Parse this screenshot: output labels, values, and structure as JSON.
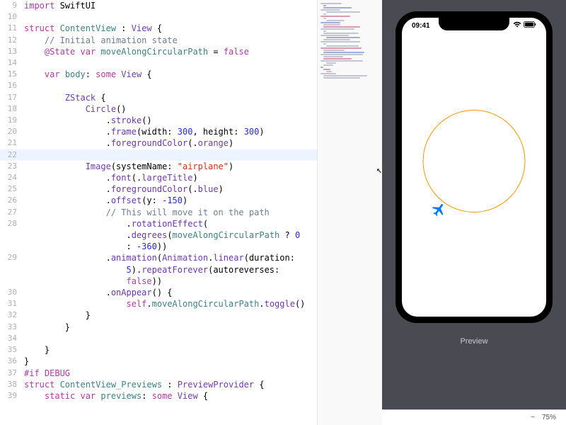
{
  "editor": {
    "lines": [
      {
        "n": 9,
        "indent": 0,
        "tokens": [
          [
            "import ",
            "kw-pink"
          ],
          [
            "SwiftUI",
            "kw-black"
          ]
        ]
      },
      {
        "n": 10,
        "indent": 0,
        "tokens": []
      },
      {
        "n": 11,
        "indent": 0,
        "tokens": [
          [
            "struct ",
            "kw-pink"
          ],
          [
            "ContentView",
            "kw-type-user"
          ],
          [
            " : ",
            "kw-black"
          ],
          [
            "View",
            "kw-purple-type"
          ],
          [
            " {",
            "kw-black"
          ]
        ]
      },
      {
        "n": 12,
        "indent": 1,
        "tokens": [
          [
            "// Initial animation state",
            "kw-comment"
          ]
        ]
      },
      {
        "n": 13,
        "indent": 1,
        "tokens": [
          [
            "@State",
            "kw-pink"
          ],
          [
            " ",
            "kw-black"
          ],
          [
            "var ",
            "kw-pink"
          ],
          [
            "moveAlongCircularPath",
            "kw-prop"
          ],
          [
            " = ",
            "kw-black"
          ],
          [
            "false",
            "kw-bool"
          ]
        ]
      },
      {
        "n": 14,
        "indent": 0,
        "tokens": []
      },
      {
        "n": 15,
        "indent": 1,
        "tokens": [
          [
            "var ",
            "kw-pink"
          ],
          [
            "body",
            "kw-prop"
          ],
          [
            ": ",
            "kw-black"
          ],
          [
            "some ",
            "kw-pink"
          ],
          [
            "View",
            "kw-purple-type"
          ],
          [
            " {",
            "kw-black"
          ]
        ]
      },
      {
        "n": 16,
        "indent": 0,
        "tokens": []
      },
      {
        "n": 17,
        "indent": 2,
        "tokens": [
          [
            "ZStack",
            "kw-purple-type"
          ],
          [
            " {",
            "kw-black"
          ]
        ]
      },
      {
        "n": 18,
        "indent": 3,
        "tokens": [
          [
            "Circle",
            "kw-purple-type"
          ],
          [
            "()",
            "kw-black"
          ]
        ]
      },
      {
        "n": 19,
        "indent": 4,
        "tokens": [
          [
            ".",
            "kw-black"
          ],
          [
            "stroke",
            "kw-method"
          ],
          [
            "()",
            "kw-black"
          ]
        ]
      },
      {
        "n": 20,
        "indent": 4,
        "tokens": [
          [
            ".",
            "kw-black"
          ],
          [
            "frame",
            "kw-method"
          ],
          [
            "(width: ",
            "kw-black"
          ],
          [
            "300",
            "kw-number"
          ],
          [
            ", height: ",
            "kw-black"
          ],
          [
            "300",
            "kw-number"
          ],
          [
            ")",
            "kw-black"
          ]
        ]
      },
      {
        "n": 21,
        "indent": 4,
        "tokens": [
          [
            ".",
            "kw-black"
          ],
          [
            "foregroundColor",
            "kw-method"
          ],
          [
            "(.",
            "kw-black"
          ],
          [
            "orange",
            "kw-enum"
          ],
          [
            ")",
            "kw-black"
          ]
        ]
      },
      {
        "n": 22,
        "indent": 4,
        "current": true,
        "tokens": []
      },
      {
        "n": 23,
        "indent": 3,
        "tokens": [
          [
            "Image",
            "kw-purple-type"
          ],
          [
            "(systemName: ",
            "kw-black"
          ],
          [
            "\"airplane\"",
            "kw-string"
          ],
          [
            ")",
            "kw-black"
          ]
        ]
      },
      {
        "n": 24,
        "indent": 4,
        "tokens": [
          [
            ".",
            "kw-black"
          ],
          [
            "font",
            "kw-method"
          ],
          [
            "(.",
            "kw-black"
          ],
          [
            "largeTitle",
            "kw-enum"
          ],
          [
            ")",
            "kw-black"
          ]
        ]
      },
      {
        "n": 25,
        "indent": 4,
        "tokens": [
          [
            ".",
            "kw-black"
          ],
          [
            "foregroundColor",
            "kw-method"
          ],
          [
            "(.",
            "kw-black"
          ],
          [
            "blue",
            "kw-enum"
          ],
          [
            ")",
            "kw-black"
          ]
        ]
      },
      {
        "n": 26,
        "indent": 4,
        "tokens": [
          [
            ".",
            "kw-black"
          ],
          [
            "offset",
            "kw-method"
          ],
          [
            "(y: ",
            "kw-black"
          ],
          [
            "-150",
            "kw-number"
          ],
          [
            ")",
            "kw-black"
          ]
        ]
      },
      {
        "n": 27,
        "indent": 4,
        "tokens": [
          [
            "// This will move it on the path",
            "kw-comment"
          ]
        ]
      },
      {
        "n": 28,
        "indent": 0,
        "multi": [
          {
            "indent": 5,
            "tokens": [
              [
                ".",
                "kw-black"
              ],
              [
                "rotationEffect",
                "kw-method"
              ],
              [
                "(",
                "kw-black"
              ]
            ]
          },
          {
            "indent": 5,
            "tokens": [
              [
                ".",
                "kw-black"
              ],
              [
                "degrees",
                "kw-method"
              ],
              [
                "(",
                "kw-black"
              ],
              [
                "moveAlongCircularPath",
                "kw-prop"
              ],
              [
                " ? ",
                "kw-black"
              ],
              [
                "0",
                "kw-number"
              ]
            ]
          },
          {
            "indent": 5,
            "tokens": [
              [
                ": ",
                "kw-black"
              ],
              [
                "-360",
                "kw-number"
              ],
              [
                "))",
                "kw-black"
              ]
            ]
          }
        ]
      },
      {
        "n": 29,
        "indent": 0,
        "multi": [
          {
            "indent": 4,
            "tokens": [
              [
                ".",
                "kw-black"
              ],
              [
                "animation",
                "kw-method"
              ],
              [
                "(",
                "kw-black"
              ],
              [
                "Animation",
                "kw-purple-type"
              ],
              [
                ".",
                "kw-black"
              ],
              [
                "linear",
                "kw-method"
              ],
              [
                "(duration:",
                "kw-black"
              ]
            ]
          },
          {
            "indent": 5,
            "tokens": [
              [
                "5",
                "kw-number"
              ],
              [
                ").",
                "kw-black"
              ],
              [
                "repeatForever",
                "kw-method"
              ],
              [
                "(autoreverses:",
                "kw-black"
              ]
            ]
          },
          {
            "indent": 5,
            "tokens": [
              [
                "false",
                "kw-bool"
              ],
              [
                "))",
                "kw-black"
              ]
            ]
          }
        ]
      },
      {
        "n": 30,
        "indent": 4,
        "tokens": [
          [
            ".",
            "kw-black"
          ],
          [
            "onAppear",
            "kw-method"
          ],
          [
            "() {",
            "kw-black"
          ]
        ]
      },
      {
        "n": 31,
        "indent": 5,
        "tokens": [
          [
            "self",
            "kw-pink"
          ],
          [
            ".",
            "kw-black"
          ],
          [
            "moveAlongCircularPath",
            "kw-prop"
          ],
          [
            ".",
            "kw-black"
          ],
          [
            "toggle",
            "kw-method"
          ],
          [
            "()",
            "kw-black"
          ]
        ]
      },
      {
        "n": 32,
        "indent": 3,
        "tokens": [
          [
            "}",
            "kw-black"
          ]
        ]
      },
      {
        "n": 33,
        "indent": 2,
        "tokens": [
          [
            "}",
            "kw-black"
          ]
        ]
      },
      {
        "n": 34,
        "indent": 0,
        "tokens": []
      },
      {
        "n": 35,
        "indent": 1,
        "tokens": [
          [
            "}",
            "kw-black"
          ]
        ]
      },
      {
        "n": 36,
        "indent": 0,
        "tokens": [
          [
            "}",
            "kw-black"
          ]
        ]
      },
      {
        "n": 37,
        "indent": 0,
        "tokens": [
          [
            "#if DEBUG",
            "kw-pink"
          ]
        ]
      },
      {
        "n": 38,
        "indent": 0,
        "tokens": [
          [
            "struct ",
            "kw-pink"
          ],
          [
            "ContentView_Previews",
            "kw-type-user"
          ],
          [
            " : ",
            "kw-black"
          ],
          [
            "PreviewProvider",
            "kw-purple-type"
          ],
          [
            " {",
            "kw-black"
          ]
        ]
      },
      {
        "n": 39,
        "indent": 1,
        "tokens": [
          [
            "static ",
            "kw-pink"
          ],
          [
            "var ",
            "kw-pink"
          ],
          [
            "previews",
            "kw-prop"
          ],
          [
            ": ",
            "kw-black"
          ],
          [
            "some ",
            "kw-pink"
          ],
          [
            "View",
            "kw-purple-type"
          ],
          [
            " {",
            "kw-black"
          ]
        ]
      }
    ],
    "indentUnit": "    "
  },
  "preview": {
    "label": "Preview",
    "statusTime": "09:41",
    "zoom": "75%"
  },
  "minimap": {
    "widths": [
      30,
      4,
      40,
      28,
      48,
      4,
      42,
      4,
      26,
      28,
      24,
      52,
      48,
      4,
      50,
      40,
      48,
      38,
      56,
      4,
      46,
      58,
      30,
      58,
      60,
      28,
      40,
      60,
      14,
      14,
      4,
      10,
      8,
      22,
      62,
      52
    ]
  }
}
